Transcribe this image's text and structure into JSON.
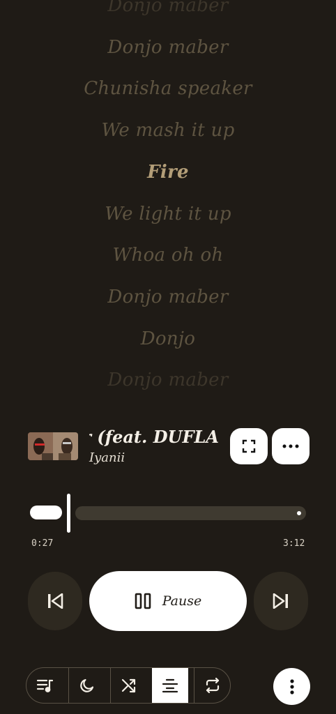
{
  "lyrics": [
    {
      "text": "Donjo maber",
      "state": "dim"
    },
    {
      "text": "Donjo maber",
      "state": "normal"
    },
    {
      "text": "Chunisha speaker",
      "state": "normal"
    },
    {
      "text": "We mash it up",
      "state": "normal"
    },
    {
      "text": "Fire",
      "state": "active"
    },
    {
      "text": "We light it up",
      "state": "normal"
    },
    {
      "text": "Whoa oh oh",
      "state": "normal"
    },
    {
      "text": "Donjo maber",
      "state": "normal"
    },
    {
      "text": "Donjo",
      "state": "normal"
    },
    {
      "text": "Donjo maber",
      "state": "dim"
    }
  ],
  "now_playing": {
    "title": "er (feat. DUFLA",
    "artist": "Iyanii"
  },
  "progress": {
    "elapsed": "0:27",
    "duration": "3:12",
    "fraction": 0.14
  },
  "controls": {
    "pause_label": "Pause"
  },
  "icons": {
    "fullscreen": "fullscreen-icon",
    "options": "more-horizontal-icon",
    "previous": "skip-previous-icon",
    "pause": "pause-icon",
    "next": "skip-next-icon",
    "queue": "queue-music-icon",
    "sleep": "moon-icon",
    "shuffle": "shuffle-icon",
    "lyrics": "center-align-icon",
    "repeat": "repeat-icon",
    "more": "more-vertical-icon"
  },
  "colors": {
    "background": "#1f1b16",
    "lyric": "#5e5441",
    "lyric_active": "#b39e78",
    "accent": "#ffffff"
  }
}
